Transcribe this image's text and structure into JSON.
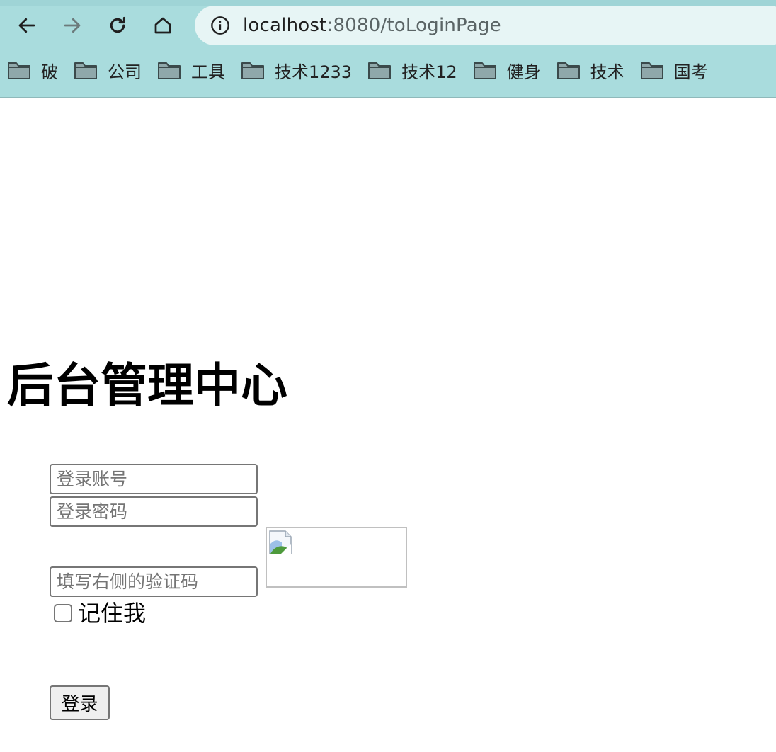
{
  "browser": {
    "url_host": "localhost",
    "url_rest": ":8080/toLoginPage",
    "bookmarks": [
      {
        "label": "破"
      },
      {
        "label": "公司"
      },
      {
        "label": "工具"
      },
      {
        "label": "技术1233"
      },
      {
        "label": "技术12"
      },
      {
        "label": "健身"
      },
      {
        "label": "技术"
      },
      {
        "label": "国考"
      }
    ]
  },
  "page": {
    "title": "后台管理中心",
    "account_placeholder": "登录账号",
    "password_placeholder": "登录密码",
    "captcha_placeholder": "填写右侧的验证码",
    "remember_label": "记住我",
    "login_label": "登录"
  },
  "icons": {
    "back": "back-arrow-icon",
    "forward": "forward-arrow-icon",
    "reload": "reload-icon",
    "home": "home-icon",
    "info": "info-icon",
    "folder": "folder-icon",
    "broken_image": "broken-image-icon"
  }
}
